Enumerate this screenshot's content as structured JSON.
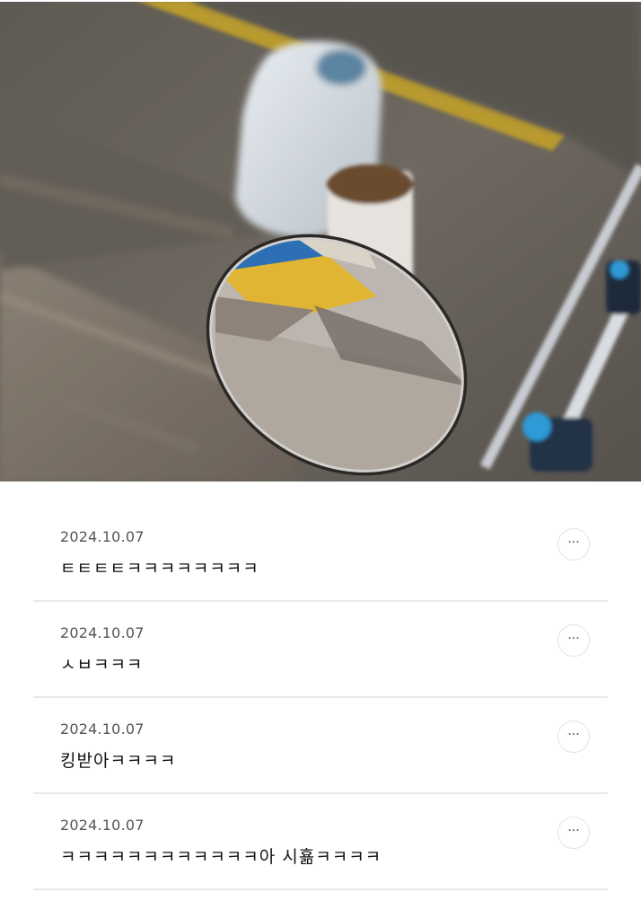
{
  "photo": {
    "description_icon": "motorcycle-mirror-photo"
  },
  "comments": [
    {
      "date": "2024.10.07",
      "text": "ㅌㅌㅌㅌㅋㅋㅋㅋㅋㅋㅋㅋ",
      "more_icon": "more-dots-icon",
      "more_label": "···"
    },
    {
      "date": "2024.10.07",
      "text": "ㅅㅂㅋㅋㅋ",
      "more_icon": "more-dots-icon",
      "more_label": "···"
    },
    {
      "date": "2024.10.07",
      "text": "킹받아ㅋㅋㅋㅋ",
      "more_icon": "more-dots-icon",
      "more_label": "···"
    },
    {
      "date": "2024.10.07",
      "text": "ㅋㅋㅋㅋㅋㅋㅋㅋㅋㅋㅋㅋ아 시횲ㅋㅋㅋㅋ",
      "more_icon": "more-dots-icon",
      "more_label": "···"
    }
  ]
}
